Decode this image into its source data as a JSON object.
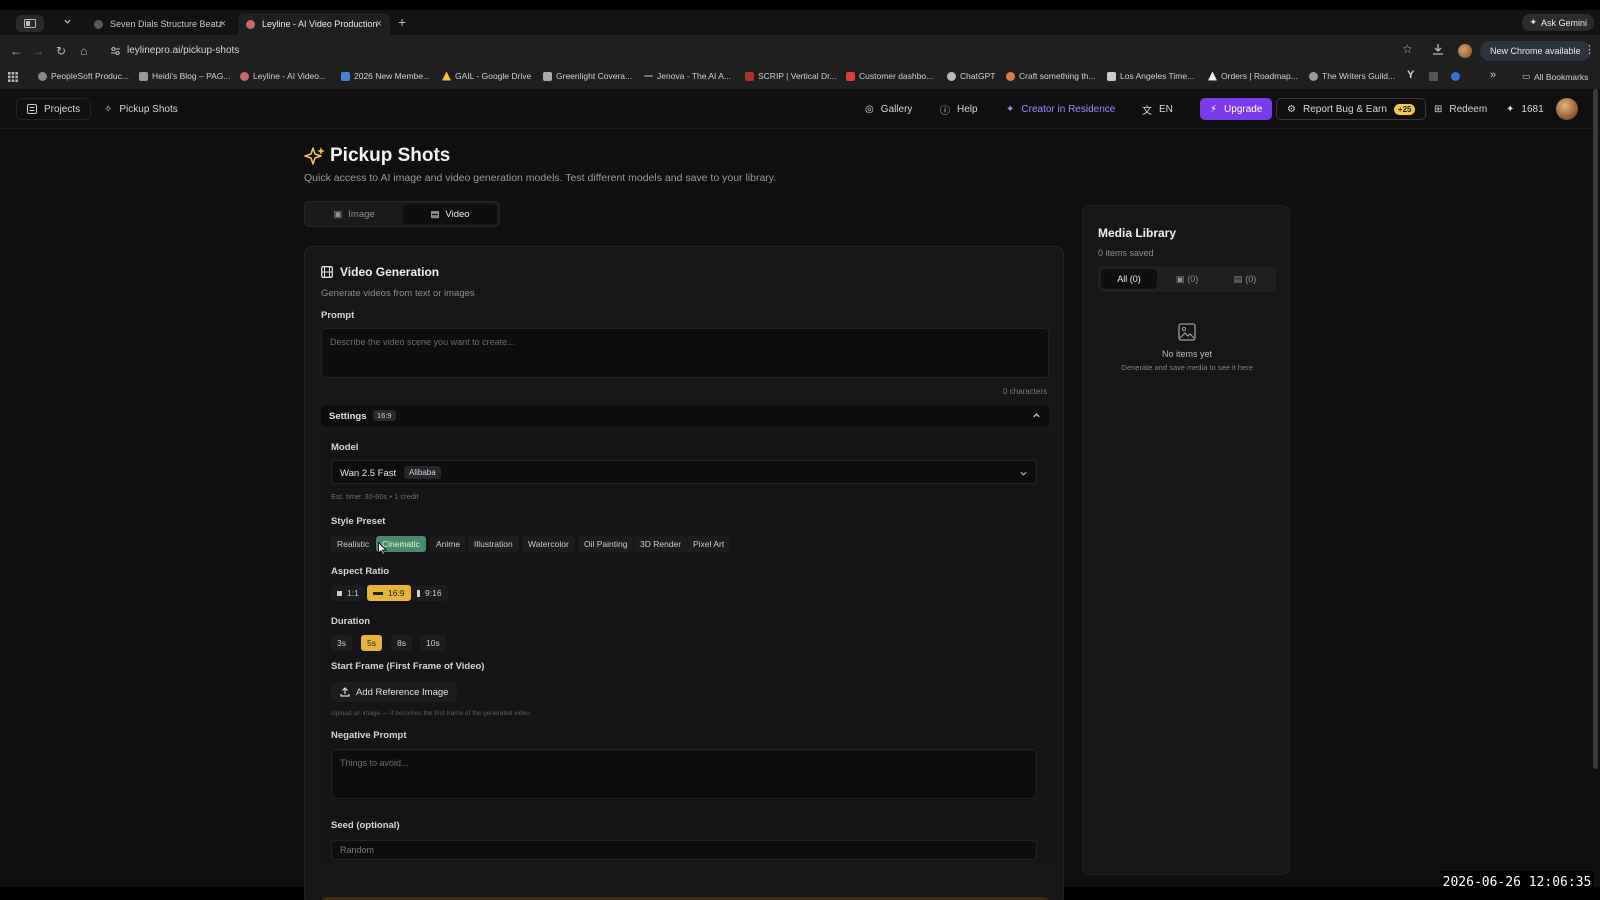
{
  "browser": {
    "tabs": [
      {
        "title": "Seven Dials Structure Beatz",
        "close": "×"
      },
      {
        "title": "Leyline - AI Video Production",
        "close": "×"
      }
    ],
    "new_tab": "+",
    "ask_gemini": "Ask Gemini",
    "url": "leylinepro.ai/pickup-shots",
    "new_chrome": "New Chrome available",
    "bookmarks": [
      "PeopleSoft Produc...",
      "Heidi's Blog – PAG...",
      "Leyline - AI Video...",
      "2026 New Membe...",
      "GAIL - Google Drive",
      "Greenlight Covera...",
      "Jenova - The AI A...",
      "SCRIP | Vertical Dr...",
      "Customer dashbo...",
      "ChatGPT",
      "Craft something th...",
      "Los Angeles Time...",
      "Orders | Roadmap...",
      "The Writers Guild..."
    ],
    "all_bookmarks": "All Bookmarks",
    "more": "»"
  },
  "nav": {
    "projects": "Projects",
    "pickup": "Pickup Shots",
    "gallery": "Gallery",
    "help": "Help",
    "creator": "Creator in Residence",
    "lang": "EN",
    "upgrade": "Upgrade",
    "report": "Report Bug & Earn",
    "report_badge": "+25",
    "redeem": "Redeem",
    "credits": "1681"
  },
  "page": {
    "title": "Pickup Shots",
    "subtitle": "Quick access to AI image and video generation models. Test different models and save to your library.",
    "tabs": {
      "image": "Image",
      "video": "Video"
    }
  },
  "card": {
    "title": "Video Generation",
    "subtitle": "Generate videos from text or images",
    "prompt_label": "Prompt",
    "prompt_placeholder": "Describe the video scene you want to create...",
    "chars": "0 characters",
    "settings": "Settings",
    "settings_badge": "16:9",
    "model_label": "Model",
    "model_name": "Wan 2.5 Fast",
    "model_provider": "Alibaba",
    "est": "Est. time: 30-60s • 1 credit",
    "style_label": "Style Preset",
    "styles": [
      "Realistic",
      "Cinematic",
      "Anime",
      "Illustration",
      "Watercolor",
      "Oil Painting",
      "3D Render",
      "Pixel Art"
    ],
    "aspect_label": "Aspect Ratio",
    "aspects": [
      "1:1",
      "16:9",
      "9:16"
    ],
    "duration_label": "Duration",
    "durations": [
      "3s",
      "5s",
      "8s",
      "10s"
    ],
    "start_label": "Start Frame (First Frame of Video)",
    "add_ref": "Add Reference Image",
    "upload_hint": "Upload an image — it becomes the first frame of the generated video",
    "neg_label": "Negative Prompt",
    "neg_placeholder": "Things to avoid...",
    "seed_label": "Seed (optional)",
    "seed_placeholder": "Random"
  },
  "media": {
    "title": "Media Library",
    "count": "0 items saved",
    "tab_all": "All (0)",
    "tab_img": "(0)",
    "tab_vid": "(0)",
    "empty_title": "No items yet",
    "empty_sub": "Generate and save media to see it here"
  },
  "clock": "2026-06-26 12:06:35",
  "colors": {
    "accent": "#7c3aed",
    "selected": "#e6b43a",
    "cinematic": "#4a8a6a",
    "creator": "#9d8cff"
  }
}
